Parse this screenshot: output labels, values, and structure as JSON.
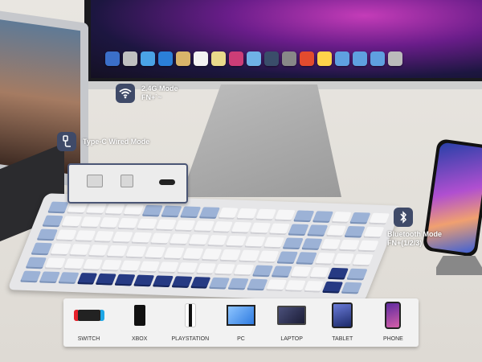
{
  "modes": {
    "wireless_2_4g": {
      "title": "2.4G Mode",
      "shortcut": "FN+`~",
      "icon": "wifi-icon"
    },
    "wired": {
      "title": "Type-C Wired Mode",
      "icon": "usb-cable-icon"
    },
    "bluetooth": {
      "title": "Bluetooth Mode",
      "shortcut": "FN+(1/2/3)",
      "icon": "bluetooth-icon"
    }
  },
  "devices": [
    {
      "label": "SWITCH",
      "icon": "nintendo-switch-icon"
    },
    {
      "label": "XBOX",
      "icon": "xbox-icon"
    },
    {
      "label": "PLAYSTATION",
      "icon": "playstation-icon"
    },
    {
      "label": "PC",
      "icon": "pc-monitor-icon"
    },
    {
      "label": "LAPTOP",
      "icon": "laptop-icon"
    },
    {
      "label": "TABLET",
      "icon": "tablet-icon"
    },
    {
      "label": "PHONE",
      "icon": "phone-icon"
    }
  ],
  "colors": {
    "badge": "#3f4a68",
    "accent_navy": "#263a83",
    "accent_blue": "#9cb2d6"
  }
}
